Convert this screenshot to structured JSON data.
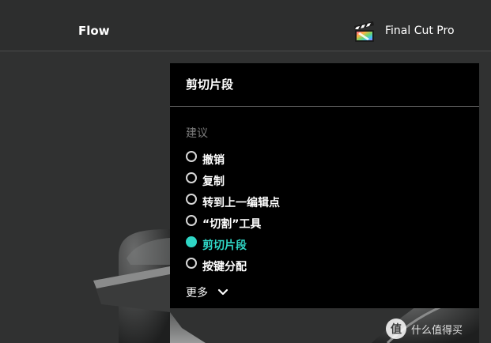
{
  "header": {
    "title": "Flow",
    "app_name": "Final Cut Pro",
    "app_icon": "final-cut-pro-clapper-icon"
  },
  "panel": {
    "title": "剪切片段",
    "suggestion_heading": "建议",
    "options": [
      {
        "label": "撤销",
        "selected": false
      },
      {
        "label": "复制",
        "selected": false
      },
      {
        "label": "转到上一编辑点",
        "selected": false
      },
      {
        "label": "“切割”工具",
        "selected": false
      },
      {
        "label": "剪切片段",
        "selected": true
      },
      {
        "label": "按键分配",
        "selected": false
      }
    ],
    "more_label": "更多",
    "more_icon": "chevron-down-icon"
  },
  "watermark": {
    "logo_text": "值",
    "text": "什么值得买"
  },
  "colors": {
    "accent": "#2fd6c5",
    "panel_bg": "#000000",
    "page_bg": "#303131"
  }
}
